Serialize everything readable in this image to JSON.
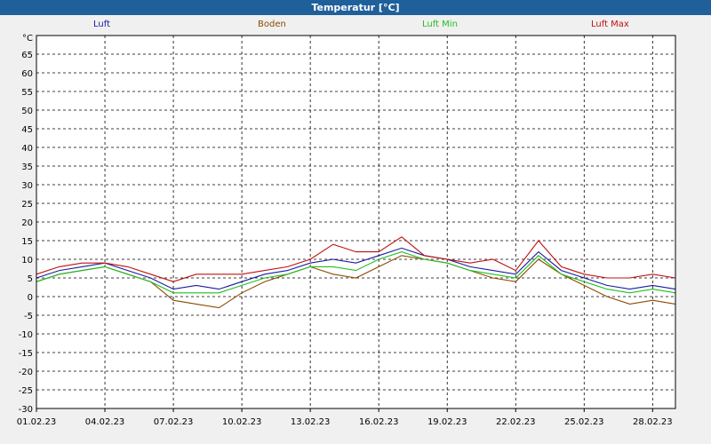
{
  "window": {
    "title": "Temperatur [°C]"
  },
  "chart_data": {
    "type": "line",
    "title": "Temperatur [°C]",
    "ylabel": "°C",
    "ylim": [
      -30,
      70
    ],
    "yticks": [
      -30,
      -25,
      -20,
      -15,
      -10,
      -5,
      0,
      5,
      10,
      15,
      20,
      25,
      30,
      35,
      40,
      45,
      50,
      55,
      60,
      65
    ],
    "x_ticks": [
      "01.02.23",
      "04.02.23",
      "07.02.23",
      "10.02.23",
      "13.02.23",
      "16.02.23",
      "19.02.23",
      "22.02.23",
      "25.02.23",
      "28.02.23"
    ],
    "x_range_days": [
      1,
      29
    ],
    "grid": true,
    "legend": "top",
    "x": [
      "01.02.23",
      "02.02.23",
      "03.02.23",
      "04.02.23",
      "05.02.23",
      "06.02.23",
      "07.02.23",
      "08.02.23",
      "09.02.23",
      "10.02.23",
      "11.02.23",
      "12.02.23",
      "13.02.23",
      "14.02.23",
      "15.02.23",
      "16.02.23",
      "17.02.23",
      "18.02.23",
      "19.02.23",
      "20.02.23",
      "21.02.23",
      "22.02.23",
      "23.02.23",
      "24.02.23",
      "25.02.23",
      "26.02.23",
      "27.02.23",
      "28.02.23",
      "01.03.23"
    ],
    "series": [
      {
        "name": "Luft",
        "color": "#1a1aa0",
        "values": [
          5,
          7,
          8,
          9,
          7,
          5,
          2,
          3,
          2,
          4,
          6,
          7,
          9,
          10,
          9,
          11,
          13,
          11,
          10,
          8,
          7,
          6,
          12,
          7,
          5,
          3,
          2,
          3,
          2
        ]
      },
      {
        "name": "Boden",
        "color": "#8b4a00",
        "values": [
          4,
          6,
          7,
          8,
          6,
          4,
          -1,
          -2,
          -3,
          1,
          4,
          6,
          8,
          6,
          5,
          8,
          11,
          10,
          9,
          7,
          5,
          4,
          10,
          6,
          3,
          0,
          -2,
          -1,
          -2
        ]
      },
      {
        "name": "Luft Min",
        "color": "#1fbf1f",
        "values": [
          4,
          6,
          7,
          8,
          6,
          4,
          1,
          1,
          1,
          3,
          5,
          6,
          8,
          8,
          7,
          10,
          12,
          10,
          9,
          7,
          6,
          5,
          11,
          6,
          4,
          2,
          1,
          2,
          1
        ]
      },
      {
        "name": "Luft Max",
        "color": "#c01010",
        "values": [
          6,
          8,
          9,
          9,
          8,
          6,
          4,
          6,
          6,
          6,
          7,
          8,
          10,
          14,
          12,
          12,
          16,
          11,
          10,
          9,
          10,
          7,
          15,
          8,
          6,
          5,
          5,
          6,
          5
        ]
      }
    ]
  }
}
